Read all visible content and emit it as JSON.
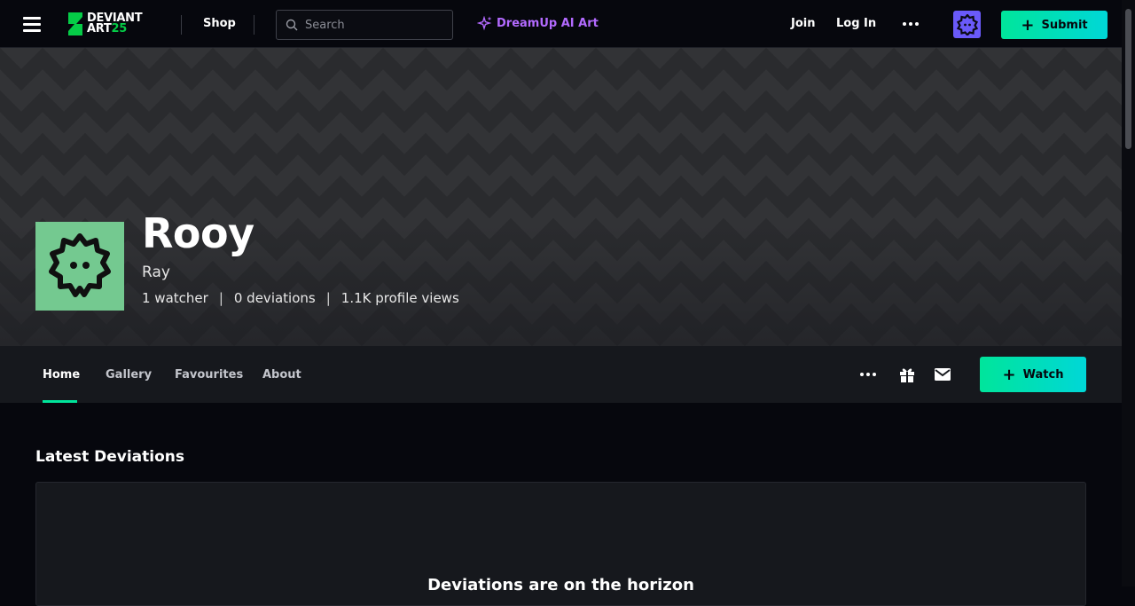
{
  "header": {
    "logo_line1": "DEVIANT",
    "logo_line2": "ART",
    "logo_year": "25",
    "shop_label": "Shop",
    "search_placeholder": "Search",
    "dreamup_label": "DreamUp AI Art",
    "join_label": "Join",
    "login_label": "Log In",
    "submit_label": "Submit"
  },
  "profile": {
    "name": "Rooy",
    "subtitle": "Ray",
    "stats": [
      "1 watcher",
      "0 deviations",
      "1.1K profile views"
    ]
  },
  "tabs": [
    {
      "label": "Home",
      "active": true
    },
    {
      "label": "Gallery",
      "active": false
    },
    {
      "label": "Favourites",
      "active": false
    },
    {
      "label": "About",
      "active": false
    }
  ],
  "actions": {
    "watch_label": "Watch"
  },
  "content": {
    "section_title": "Latest Deviations",
    "empty_message": "Deviations are on the horizon"
  },
  "colors": {
    "accent_green": "#00e59b",
    "accent_cyan": "#00d7d7",
    "dreamup_purple": "#b36aff",
    "avatar_bg": "#74c990",
    "top_avatar_bg": "#6a5af9"
  }
}
